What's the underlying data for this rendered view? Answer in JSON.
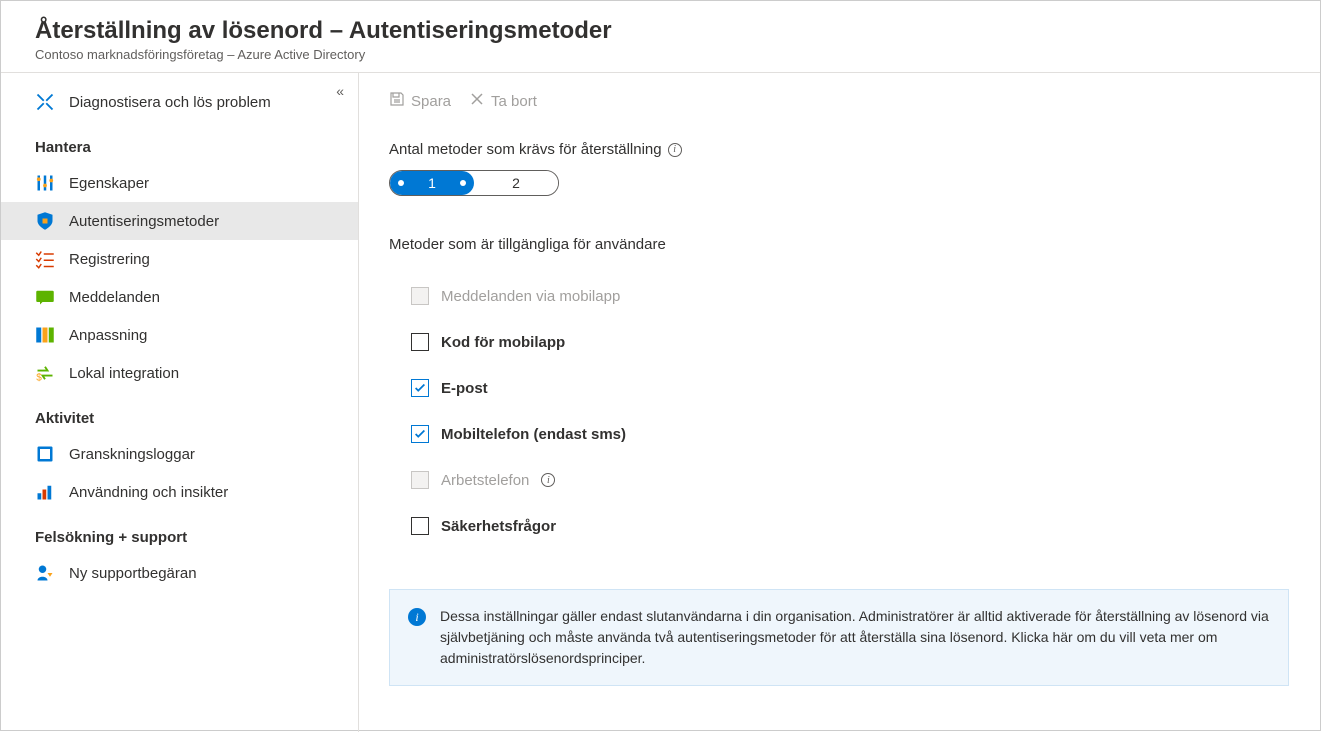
{
  "header": {
    "title": "Återställning av lösenord – Autentiseringsmetoder",
    "breadcrumb": "Contoso marknadsföringsföretag – Azure Active Directory"
  },
  "sidebar": {
    "diagnose": "Diagnostisera och lös problem",
    "sections": {
      "manage": "Hantera",
      "activity": "Aktivitet",
      "troubleshoot": "Felsökning + support"
    },
    "items": {
      "properties": "Egenskaper",
      "authMethods": "Autentiseringsmetoder",
      "registration": "Registrering",
      "notifications": "Meddelanden",
      "customization": "Anpassning",
      "onprem": "Lokal integration",
      "auditLogs": "Granskningsloggar",
      "usage": "Användning och insikter",
      "support": "Ny supportbegäran"
    }
  },
  "toolbar": {
    "save": "Spara",
    "discard": "Ta bort"
  },
  "form": {
    "methodsRequiredLabel": "Antal metoder som krävs för återställning",
    "option1": "1",
    "option2": "2",
    "methodsAvailableLabel": "Metoder som är tillgängliga för användare",
    "methods": {
      "mobileAppNotification": "Meddelanden via mobilapp",
      "mobileAppCode": "Kod för mobilapp",
      "email": "E-post",
      "mobilePhone": "Mobiltelefon (endast sms)",
      "officePhone": "Arbetstelefon",
      "securityQuestions": "Säkerhetsfrågor"
    }
  },
  "infoBox": "Dessa inställningar gäller endast slutanvändarna i din organisation. Administratörer är alltid aktiverade för återställning av lösenord via självbetjäning och  måste använda två autentiseringsmetoder för att återställa sina lösenord. Klicka här om du vill veta mer om  administratörslösenordsprinciper."
}
